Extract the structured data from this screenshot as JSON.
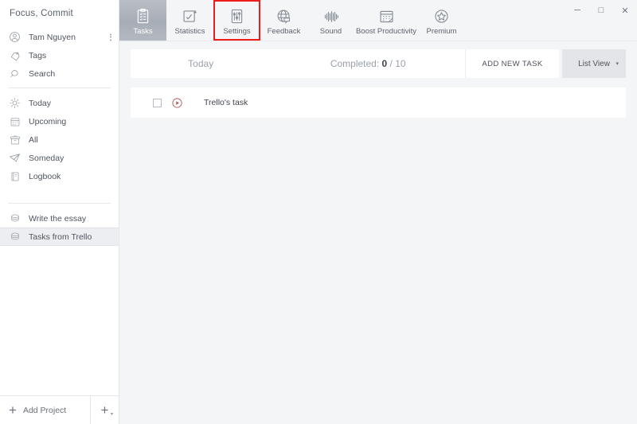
{
  "app": {
    "brand": "Focus, Commit"
  },
  "window_controls": {
    "minimize": "─",
    "maximize": "□",
    "close": "✕"
  },
  "sidebar": {
    "account": {
      "name": "Tam Nguyen",
      "icon": "user-circle-icon",
      "menu_icon": "kebab-menu-icon"
    },
    "quick_items": [
      {
        "label": "Tags",
        "icon": "tag-icon"
      },
      {
        "label": "Search",
        "icon": "search-icon"
      }
    ],
    "nav_items": [
      {
        "label": "Today",
        "icon": "sun-icon"
      },
      {
        "label": "Upcoming",
        "icon": "calendar-icon"
      },
      {
        "label": "All",
        "icon": "archive-box-icon"
      },
      {
        "label": "Someday",
        "icon": "paper-plane-icon"
      },
      {
        "label": "Logbook",
        "icon": "book-icon"
      }
    ],
    "projects": [
      {
        "label": "Write the essay",
        "icon": "layers-icon",
        "selected": false
      },
      {
        "label": "Tasks from Trello",
        "icon": "layers-icon",
        "selected": true
      }
    ],
    "footer": {
      "add_project_label": "Add Project",
      "add_project_icon": "plus-icon",
      "add_list_icon": "plus-icon",
      "add_list_caret": "▾"
    }
  },
  "toolbar": {
    "tabs": [
      {
        "label": "Tasks",
        "icon": "clipboard-checklist-icon",
        "active": true,
        "highlighted": false
      },
      {
        "label": "Statistics",
        "icon": "chart-check-icon",
        "active": false,
        "highlighted": false
      },
      {
        "label": "Settings",
        "icon": "sliders-icon",
        "active": false,
        "highlighted": true
      },
      {
        "label": "Feedback",
        "icon": "globe-speech-icon",
        "active": false,
        "highlighted": false
      },
      {
        "label": "Sound",
        "icon": "waveform-icon",
        "active": false,
        "highlighted": false
      },
      {
        "label": "Boost Productivity",
        "icon": "calendar-boost-icon",
        "active": false,
        "highlighted": false
      },
      {
        "label": "Premium",
        "icon": "star-circle-icon",
        "active": false,
        "highlighted": false
      }
    ],
    "highlight_color": "#f01c1c"
  },
  "content": {
    "header": {
      "today_label": "Today",
      "completed_prefix": "Completed: ",
      "completed_count": "0",
      "completed_suffix": " / 10",
      "add_new_task_label": "ADD NEW TASK",
      "view_label": "List View",
      "view_caret": "▾"
    },
    "tasks": [
      {
        "title": "Trello's task",
        "checked": false,
        "play_icon": "play-circle-icon",
        "play_color": "#bc5b5b"
      }
    ]
  }
}
